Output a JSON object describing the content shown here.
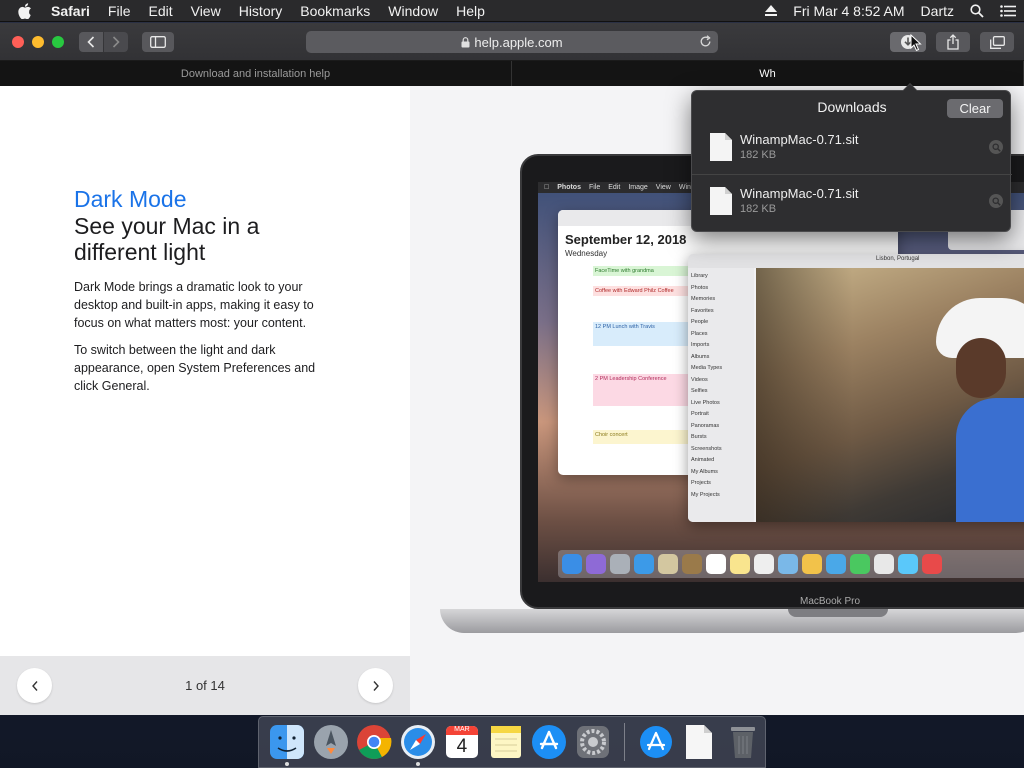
{
  "menubar": {
    "app_name": "Safari",
    "menus": [
      "File",
      "Edit",
      "View",
      "History",
      "Bookmarks",
      "Window",
      "Help"
    ],
    "clock": "Fri Mar 4  8:52 AM",
    "user": "Dartz"
  },
  "toolbar": {
    "url": "help.apple.com"
  },
  "tabs": [
    {
      "label": "Download and installation help",
      "active": false
    },
    {
      "label": "Wh",
      "active": true
    }
  ],
  "content": {
    "eyebrow": "Dark Mode",
    "headline": "See your Mac in a different light",
    "paragraph1": "Dark Mode brings a dramatic look to your desktop and built-in apps, making it easy to focus on what matters most: your content.",
    "paragraph2": "To switch between the light and dark appearance, open System Preferences and click General.",
    "pager": "1 of 14",
    "laptop_label": "MacBook Pro"
  },
  "illustration": {
    "menubar_items": [
      "Photos",
      "File",
      "Edit",
      "Image",
      "View",
      "Window"
    ],
    "cal_date": "September 12, 2018",
    "cal_day": "Wednesday",
    "events": [
      {
        "label": "FaceTime with grandma",
        "color": "#d9f5d5"
      },
      {
        "label": "Coffee with Edward  Philz Coffee",
        "color": "#fde0e0"
      },
      {
        "label": "12 PM Lunch with Travis",
        "color": "#d8ecfb"
      },
      {
        "label": "2 PM Leadership Conference",
        "color": "#fcd9e4"
      },
      {
        "label": "Choir concert",
        "color": "#fcf5cf"
      }
    ],
    "photos_sidebar": [
      "Library",
      "Photos",
      "Memories",
      "Favorites",
      "People",
      "Places",
      "Imports",
      "Albums",
      "Media Types",
      "Videos",
      "Selfies",
      "Live Photos",
      "Portrait",
      "Panoramas",
      "Bursts",
      "Screenshots",
      "Animated",
      "My Albums",
      "Projects",
      "My Projects"
    ],
    "photo_location": "Lisbon, Portugal"
  },
  "downloads": {
    "title": "Downloads",
    "clear_label": "Clear",
    "items": [
      {
        "name": "WinampMac-0.71.sit",
        "size": "182 KB"
      },
      {
        "name": "WinampMac-0.71.sit",
        "size": "182 KB"
      }
    ]
  },
  "dock": {
    "apps": [
      "finder-icon",
      "launchpad-icon",
      "chrome-icon",
      "safari-icon",
      "calendar-icon",
      "notes-icon",
      "app-store-icon",
      "system-preferences-icon",
      "downloads-folder-icon",
      "document-icon",
      "trash-icon"
    ],
    "calendar_month": "MAR",
    "calendar_day": "4"
  }
}
